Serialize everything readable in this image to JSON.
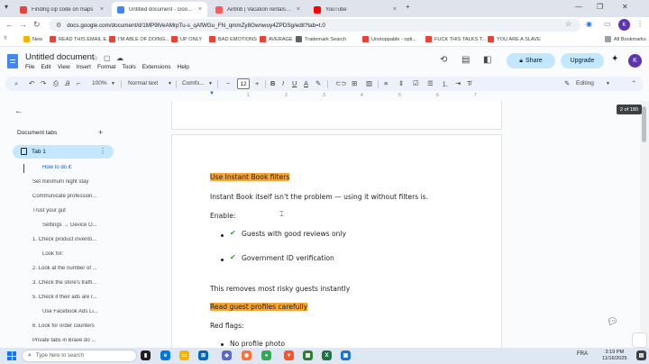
{
  "browser": {
    "tabs": [
      {
        "title": "Finding cip code on maps",
        "color": "#ea4335",
        "active": false
      },
      {
        "title": "Untitled document - Google Do",
        "color": "#4285f4",
        "active": true
      },
      {
        "title": "Airbnb | Vacation rentals, cabi",
        "color": "#ff5a5f",
        "active": false
      },
      {
        "title": "YouTube",
        "color": "#ff0000",
        "active": false
      }
    ],
    "new_tab": "+",
    "url": "docs.google.com/document/d/1MP9lVeAMrpTu-s_qAfWGu_FN_qmmZy8Gwnwuy4ZPDSg/edit?tab=t.0",
    "profile_initial": "K",
    "bookmarks": [
      {
        "label": "New",
        "color": "#f4b400"
      },
      {
        "label": "READ THIS EMAIL E...",
        "color": "#ea4335"
      },
      {
        "label": "I'M ABLE OF DOING...",
        "color": "#ea4335"
      },
      {
        "label": "UP ONLY",
        "color": "#ea4335"
      },
      {
        "label": "BAD EMOTIONS",
        "color": "#ea4335"
      },
      {
        "label": "AVERAGE",
        "color": "#ea4335"
      },
      {
        "label": "Trademark Search",
        "color": "#5f6368"
      },
      {
        "label": "Unstoppable - opti...",
        "color": "#ea4335"
      },
      {
        "label": "FUCK THIS TALKS T...",
        "color": "#ea4335"
      },
      {
        "label": "YOU ARE A SLAVE",
        "color": "#ea4335"
      }
    ],
    "all_bookmarks": "All Bookmarks"
  },
  "docs": {
    "title": "Untitled document",
    "menu": [
      "File",
      "Edit",
      "View",
      "Insert",
      "Format",
      "Tools",
      "Extensions",
      "Help"
    ],
    "share_label": "Share",
    "upgrade_label": "Upgrade",
    "avatar_initial": "K",
    "toolbar": {
      "zoom": "100%",
      "style": "Normal text",
      "font": "Comfo...",
      "font_size": "12",
      "mode": "Editing"
    },
    "ruler_ticks": [
      "1",
      "2",
      "3",
      "4",
      "5",
      "6",
      "7"
    ],
    "page_count": "2 of 180"
  },
  "sidebar": {
    "heading": "Document tabs",
    "add": "+",
    "tab_name": "Tab 1",
    "outline": [
      {
        "text": "How to do it:",
        "level": 2,
        "current": true
      },
      {
        "text": "Set minimum night stay",
        "level": 1
      },
      {
        "text": "Communicate profession...",
        "level": 1
      },
      {
        "text": "Trust your gut",
        "level": 1
      },
      {
        "text": "Settings → Device O...",
        "level": 2
      },
      {
        "text": "1. Check product invento...",
        "level": 1
      },
      {
        "text": "Look for:",
        "level": 2
      },
      {
        "text": "2. Look at the number of ...",
        "level": 1
      },
      {
        "text": "3. Check the store's traffi...",
        "level": 1
      },
      {
        "text": "5. Check if their ads are r...",
        "level": 1
      },
      {
        "text": "Use Facebook Ads Li...",
        "level": 2
      },
      {
        "text": "6. Look for order counters",
        "level": 1
      },
      {
        "text": "Private tabs in Brave do ...",
        "level": 1
      }
    ]
  },
  "document": {
    "heading1": "Use Instant Book filters",
    "para1": "Instant Book itself isn't the problem — using it without filters is.",
    "enable_label": "Enable:",
    "enable_items": [
      "Guests with good reviews only",
      "Government ID verification"
    ],
    "para2": "This removes most risky guests instantly",
    "heading2": "Read guest profiles carefully",
    "red_flags": "Red flags:",
    "flag_items": [
      "No profile photo"
    ],
    "check_glyph": "✔"
  },
  "taskbar": {
    "search_placeholder": "Type here to search",
    "lang": "FRA",
    "time": "3:19 PM",
    "date": "11/16/2025"
  }
}
